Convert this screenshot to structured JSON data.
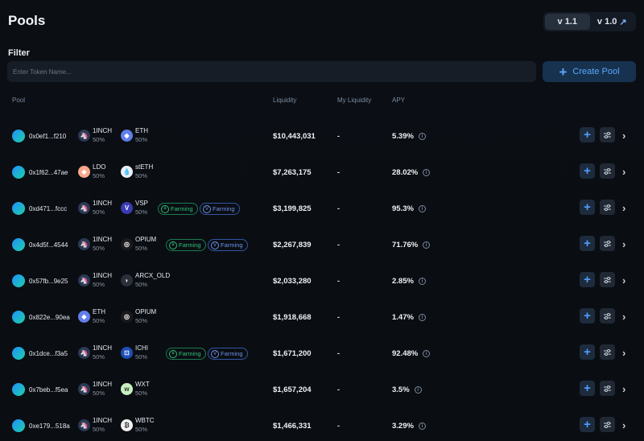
{
  "header": {
    "title": "Pools"
  },
  "versions": [
    {
      "label": "v 1.1",
      "active": true
    },
    {
      "label": "v 1.0",
      "active": false,
      "external": "↗"
    }
  ],
  "filter": {
    "label": "Filter",
    "placeholder": "Enter Token Name..."
  },
  "create_button": {
    "label": "Create Pool",
    "icon": "plus-icon"
  },
  "columns": {
    "pool": "Pool",
    "liquidity": "Liquidity",
    "my_liquidity": "My Liquidity",
    "apy": "APY"
  },
  "colors": {
    "accent": "#4f9dff",
    "farming_green": "#2fbf77",
    "farming_blue": "#6d8fe6"
  },
  "pools": [
    {
      "address": "0x0ef1...f210",
      "tokens": [
        {
          "symbol": "1INCH",
          "weight": "50%",
          "icon": "1inch-icon"
        },
        {
          "symbol": "ETH",
          "weight": "50%",
          "icon": "eth-icon"
        }
      ],
      "tags": [],
      "liquidity": "$10,443,031",
      "my_liquidity": "-",
      "apy": "5.39%"
    },
    {
      "address": "0x1f62...47ae",
      "tokens": [
        {
          "symbol": "LDO",
          "weight": "50%",
          "icon": "ldo-icon"
        },
        {
          "symbol": "stETH",
          "weight": "50%",
          "icon": "steth-icon"
        }
      ],
      "tags": [],
      "liquidity": "$7,263,175",
      "my_liquidity": "-",
      "apy": "28.02%"
    },
    {
      "address": "0xd471...fccc",
      "tokens": [
        {
          "symbol": "1INCH",
          "weight": "50%",
          "icon": "1inch-icon"
        },
        {
          "symbol": "VSP",
          "weight": "50%",
          "icon": "vsp-icon"
        }
      ],
      "tags": [
        {
          "label": "Farming",
          "style": "green"
        },
        {
          "label": "Farming",
          "style": "blue"
        }
      ],
      "liquidity": "$3,199,825",
      "my_liquidity": "-",
      "apy": "95.3%"
    },
    {
      "address": "0x4d5f...4544",
      "tokens": [
        {
          "symbol": "1INCH",
          "weight": "50%",
          "icon": "1inch-icon"
        },
        {
          "symbol": "OPIUM",
          "weight": "50%",
          "icon": "opium-icon"
        }
      ],
      "tags": [
        {
          "label": "Farming",
          "style": "green"
        },
        {
          "label": "Farming",
          "style": "blue"
        }
      ],
      "liquidity": "$2,267,839",
      "my_liquidity": "-",
      "apy": "71.76%"
    },
    {
      "address": "0x57fb...9e25",
      "tokens": [
        {
          "symbol": "1INCH",
          "weight": "50%",
          "icon": "1inch-icon"
        },
        {
          "symbol": "ARCX_OLD",
          "weight": "50%",
          "icon": "arcx-icon"
        }
      ],
      "tags": [],
      "liquidity": "$2,033,280",
      "my_liquidity": "-",
      "apy": "2.85%"
    },
    {
      "address": "0x822e...90ea",
      "tokens": [
        {
          "symbol": "ETH",
          "weight": "50%",
          "icon": "eth-icon"
        },
        {
          "symbol": "OPIUM",
          "weight": "50%",
          "icon": "opium-icon"
        }
      ],
      "tags": [],
      "liquidity": "$1,918,668",
      "my_liquidity": "-",
      "apy": "1.47%"
    },
    {
      "address": "0x1dce...f3a5",
      "tokens": [
        {
          "symbol": "1INCH",
          "weight": "50%",
          "icon": "1inch-icon"
        },
        {
          "symbol": "ICHI",
          "weight": "50%",
          "icon": "ichi-icon"
        }
      ],
      "tags": [
        {
          "label": "Farming",
          "style": "green"
        },
        {
          "label": "Farming",
          "style": "blue"
        }
      ],
      "liquidity": "$1,671,200",
      "my_liquidity": "-",
      "apy": "92.48%"
    },
    {
      "address": "0x7beb...f5ea",
      "tokens": [
        {
          "symbol": "1INCH",
          "weight": "50%",
          "icon": "1inch-icon"
        },
        {
          "symbol": "WXT",
          "weight": "50%",
          "icon": "wxt-icon"
        }
      ],
      "tags": [],
      "liquidity": "$1,657,204",
      "my_liquidity": "-",
      "apy": "3.5%"
    },
    {
      "address": "0xe179...518a",
      "tokens": [
        {
          "symbol": "1INCH",
          "weight": "50%",
          "icon": "1inch-icon"
        },
        {
          "symbol": "WBTC",
          "weight": "50%",
          "icon": "wbtc-icon"
        }
      ],
      "tags": [],
      "liquidity": "$1,466,331",
      "my_liquidity": "-",
      "apy": "3.29%"
    }
  ]
}
